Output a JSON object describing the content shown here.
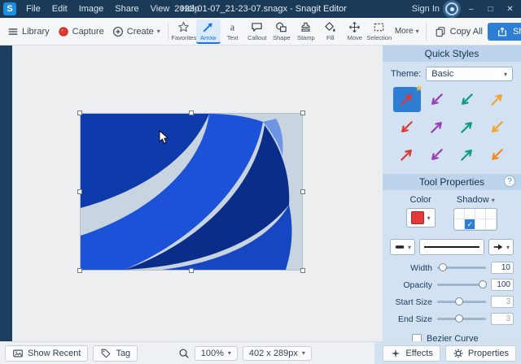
{
  "colors": {
    "accent": "#1473e6",
    "titlebar_bg": "#1b3a57",
    "panel_bg": "#d2e2f2",
    "share_button": "#2e7fd4",
    "selected_style_bg": "#2e7fd4",
    "tool_color": "#e03a3a"
  },
  "titlebar": {
    "logo": "S",
    "menus": [
      "File",
      "Edit",
      "Image",
      "Share",
      "View",
      "Help"
    ],
    "title": "2023-01-07_21-23-07.snagx - Snagit Editor",
    "sign_in": "Sign In",
    "window": {
      "minimize": "–",
      "maximize": "□",
      "close": "✕"
    }
  },
  "toolbar": {
    "library": "Library",
    "capture": "Capture",
    "create": "Create",
    "tools": [
      {
        "label": "Favorites",
        "icon": "star-icon",
        "selected": false
      },
      {
        "label": "Arrow",
        "icon": "arrow-icon",
        "selected": true
      },
      {
        "label": "Text",
        "icon": "text-icon",
        "selected": false
      },
      {
        "label": "Callout",
        "icon": "callout-icon",
        "selected": false
      },
      {
        "label": "Shape",
        "icon": "shape-icon",
        "selected": false
      },
      {
        "label": "Stamp",
        "icon": "stamp-icon",
        "selected": false
      },
      {
        "label": "Fill",
        "icon": "fill-icon",
        "selected": false
      },
      {
        "label": "Move",
        "icon": "move-icon",
        "selected": false
      },
      {
        "label": "Selection",
        "icon": "selection-icon",
        "selected": false
      }
    ],
    "more": "More",
    "copy_all": "Copy All",
    "share": "Share"
  },
  "right_panel": {
    "quick_styles": {
      "title": "Quick Styles",
      "theme_label": "Theme:",
      "theme_value": "Basic",
      "star_badge": "★",
      "styles": [
        {
          "name": "red-arrow",
          "color": "#d93a3a",
          "dir": "ne",
          "selected": true
        },
        {
          "name": "purple-arrow",
          "color": "#9b3db5",
          "dir": "sw",
          "selected": false
        },
        {
          "name": "teal-arrow",
          "color": "#0f9d8a",
          "dir": "sw",
          "selected": false
        },
        {
          "name": "yellow-arrow",
          "color": "#eda72f",
          "dir": "ne",
          "selected": false
        },
        {
          "name": "red-arrow-2",
          "color": "#d93a3a",
          "dir": "sw",
          "selected": false
        },
        {
          "name": "purple-arrow-2",
          "color": "#9b3db5",
          "dir": "ne",
          "selected": false
        },
        {
          "name": "teal-arrow-2",
          "color": "#0f9d8a",
          "dir": "ne",
          "selected": false
        },
        {
          "name": "yellow-arrow-2",
          "color": "#eda72f",
          "dir": "sw",
          "selected": false
        },
        {
          "name": "red-arrow-3",
          "color": "#d93a3a",
          "dir": "ne",
          "selected": false
        },
        {
          "name": "purple-arrow-3",
          "color": "#9b3db5",
          "dir": "sw",
          "selected": false
        },
        {
          "name": "teal-arrow-3",
          "color": "#0f9d8a",
          "dir": "ne",
          "selected": false
        },
        {
          "name": "orange-arrow",
          "color": "#ef8c1f",
          "dir": "sw",
          "selected": false
        }
      ]
    },
    "tool_properties": {
      "title": "Tool Properties",
      "help": "?",
      "color_label": "Color",
      "shadow_label": "Shadow",
      "shadow_caret": "▾",
      "shadow_check_glyph": "✓",
      "shadow_checked_cell": 6,
      "sliders": [
        {
          "label": "Width",
          "value": "10",
          "percent": "12%"
        },
        {
          "label": "Opacity",
          "value": "100",
          "percent": "93%"
        },
        {
          "label": "Start Size",
          "value": "3",
          "percent": "45%"
        },
        {
          "label": "End Size",
          "value": "3",
          "percent": "45%"
        }
      ],
      "bezier_label": "Bezier Curve"
    }
  },
  "statusbar": {
    "show_recent": "Show Recent",
    "tag": "Tag",
    "zoom": "100%",
    "size": "402 x 289px",
    "effects": "Effects",
    "properties": "Properties"
  }
}
